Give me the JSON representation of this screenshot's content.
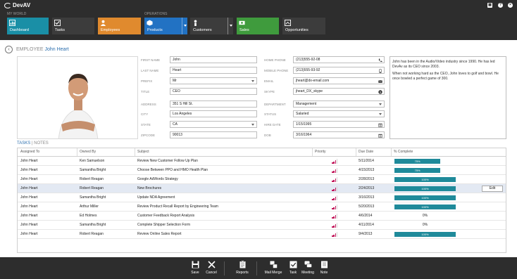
{
  "app": {
    "logo_text": "DevAV"
  },
  "titlebar": {
    "icons": [
      "grid-icon",
      "help-icon",
      "close-icon"
    ]
  },
  "nav": {
    "groups": {
      "my_world": "MY WORLD",
      "operations": "OPERATIONS"
    },
    "tiles": [
      {
        "label": "Dashboard",
        "color": "#1a8fa6"
      },
      {
        "label": "Tasks",
        "color": "#3c3c3c"
      },
      {
        "label": "Employees",
        "color": "#e08a2e"
      },
      {
        "label": "Products",
        "color": "#2272c3"
      },
      {
        "label": "Customers",
        "color": "#3c3c3c"
      },
      {
        "label": "Sales",
        "color": "#3f9b3d"
      },
      {
        "label": "Opportunities",
        "color": "#3c3c3c"
      }
    ]
  },
  "header": {
    "prefix": "EMPLOYEE",
    "name": "John Heart"
  },
  "form": {
    "first_name": {
      "label": "FIRST NAME",
      "value": "John"
    },
    "last_name": {
      "label": "LAST NAME",
      "value": "Heart"
    },
    "prefix": {
      "label": "PREFIX",
      "value": "Mr"
    },
    "title": {
      "label": "TITLE",
      "value": "CEO"
    },
    "address": {
      "label": "ADDRESS",
      "value": "351 S Hill St."
    },
    "city": {
      "label": "CITY",
      "value": "Los Angeles"
    },
    "state": {
      "label": "STATE",
      "value": "CA"
    },
    "zipcode": {
      "label": "ZIPCODE",
      "value": "90013"
    },
    "home_phone": {
      "label": "HOME PHONE",
      "value": "(213)555-92-08"
    },
    "mobile_phone": {
      "label": "MOBILE PHONE",
      "value": "(213)555-93-92"
    },
    "email": {
      "label": "EMAIL",
      "value": "jheart@dx-email.com"
    },
    "skype": {
      "label": "SKYPE",
      "value": "jheart_DX_skype"
    },
    "department": {
      "label": "DEPARTMENT",
      "value": "Management"
    },
    "status": {
      "label": "STATUS",
      "value": "Salaried"
    },
    "hire_date": {
      "label": "HIRE DATE",
      "value": "1/15/1995"
    },
    "dob": {
      "label": "DOB",
      "value": "3/16/1964"
    }
  },
  "bio": {
    "p1": "John has been in the Audio/Video industry since 1990. He has led DevAv as its CEO since 2003.",
    "p2": "When not working hard as the CEO, John loves to golf and bowl. He once bowled a perfect game of 300."
  },
  "tabs": {
    "tasks": "TASKS",
    "separator": "|",
    "notes": "NOTES"
  },
  "grid": {
    "columns": [
      "Assigned To",
      "Owned By",
      "Subject",
      "Priority",
      "Due Date",
      "% Complete"
    ],
    "rows": [
      {
        "assigned": "John Heart",
        "owner": "Ken Samuelson",
        "subject": "Review New Customer Follow Up Plan",
        "priority": 3,
        "due": "5/11/2014",
        "pct": 75,
        "pct_label": "75%"
      },
      {
        "assigned": "John Heart",
        "owner": "Samantha Bright",
        "subject": "Choose Between PPO and HMO Health Plan",
        "priority": 3,
        "due": "4/15/2013",
        "pct": 75,
        "pct_label": "75%"
      },
      {
        "assigned": "John Heart",
        "owner": "Robert Reagan",
        "subject": "Google AdWords Strategy",
        "priority": 3,
        "due": "2/28/2013",
        "pct": 100,
        "pct_label": "100%"
      },
      {
        "assigned": "John Heart",
        "owner": "Robert Reagan",
        "subject": "New Brochures",
        "priority": 3,
        "due": "2/24/2013",
        "pct": 100,
        "pct_label": "100%",
        "selected": true
      },
      {
        "assigned": "John Heart",
        "owner": "Samantha Bright",
        "subject": "Update NDA Agreement",
        "priority": 3,
        "due": "3/16/2013",
        "pct": 100,
        "pct_label": "100%"
      },
      {
        "assigned": "John Heart",
        "owner": "Arthur Miller",
        "subject": "Review Product Recall Report by Engineering Team",
        "priority": 3,
        "due": "5/20/2013",
        "pct": 100,
        "pct_label": "100%"
      },
      {
        "assigned": "John Heart",
        "owner": "Ed Holmes",
        "subject": "Customer Feedback Report Analysis",
        "priority": 3,
        "due": "4/6/2014",
        "pct": 0,
        "pct_label": "0%"
      },
      {
        "assigned": "John Heart",
        "owner": "Samantha Bright",
        "subject": "Complete Shipper Selection Form",
        "priority": 3,
        "due": "4/11/2014",
        "pct": 0,
        "pct_label": "0%"
      },
      {
        "assigned": "John Heart",
        "owner": "Robert Reagan",
        "subject": "Review Online Sales Report",
        "priority": 3,
        "due": "9/4/2013",
        "pct": 100,
        "pct_label": "100%"
      }
    ],
    "edit_label": "Edit"
  },
  "toolbar": {
    "save": "Save",
    "cancel": "Cancel",
    "reports": "Reports",
    "mail_merge": "Mail Merge",
    "task": "Task",
    "meeting": "Meeting",
    "note": "Note"
  },
  "colors": {
    "accent": "#2c6fae",
    "progress": "#1f8a9a",
    "priority": "#c2185b",
    "chrome": "#2d2d2d"
  }
}
